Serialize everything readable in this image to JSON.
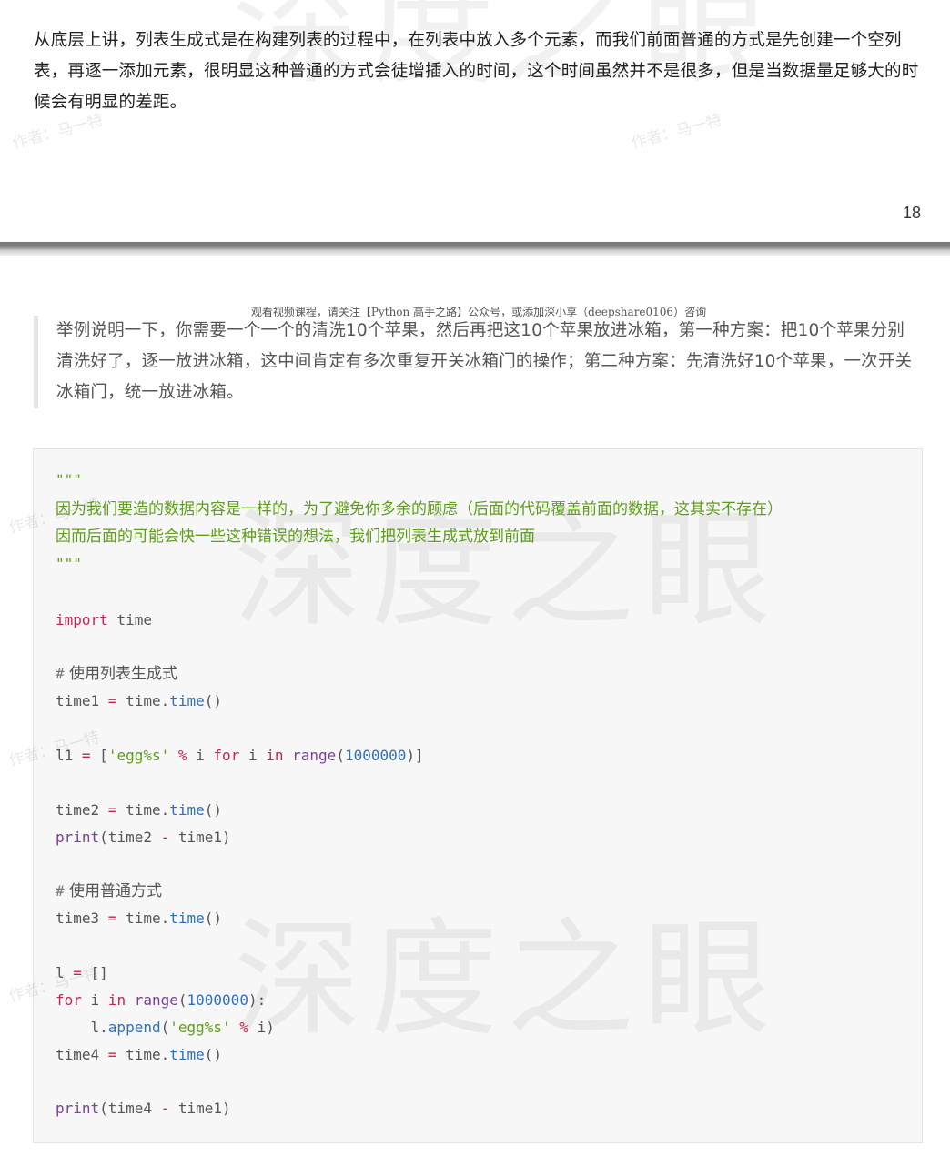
{
  "page_top": {
    "paragraph": "从底层上讲，列表生成式是在构建列表的过程中，在列表中放入多个元素，而我们前面普通的方式是先创建一个空列表，再逐一添加元素，很明显这种普通的方式会徒增插入的时间，这个时间虽然并不是很多，但是当数据量足够大的时候会有明显的差距。",
    "page_number": "18"
  },
  "page_bottom": {
    "header_note": "观看视频课程，请关注【Python 高手之路】公众号，或添加深小享（deepshare0106）咨询",
    "quote": "举例说明一下，你需要一个一个的清洗10个苹果，然后再把这10个苹果放进冰箱，第一种方案：把10个苹果分别清洗好了，逐一放进冰箱，这中间肯定有多次重复开关冰箱门的操作；第二种方案：先清洗好10个苹果，一次开关冰箱门，统一放进冰箱。"
  },
  "watermarks": {
    "big": "深度之眼",
    "small": "作者：马一特"
  },
  "code": {
    "doc_open": "\"\"\"",
    "doc_line1": "因为我们要造的数据内容是一样的，为了避免你多余的顾虑（后面的代码覆盖前面的数据，这其实不存在）",
    "doc_line2": "因而后面的可能会快一些这种错误的想法，我们把列表生成式放到前面",
    "doc_close": "\"\"\"",
    "import_kw": "import",
    "import_mod": " time",
    "comment_hash": "#",
    "comment1": " 使用列表生成式",
    "t1_var": "time1 ",
    "t1_eq": "=",
    "t1_mod": " time.",
    "t1_fn": "time",
    "t1_paren": "()",
    "l1_var": "l1 ",
    "l1_eq": "=",
    "l1_open": " [",
    "l1_str": "'egg%s'",
    "l1_mod": " %",
    "l1_i": " i ",
    "l1_for": "for",
    "l1_i2": " i ",
    "l1_in": "in",
    "l1_range": " range",
    "l1_p1": "(",
    "l1_num": "1000000",
    "l1_close": ")]",
    "t2_var": "time2 ",
    "t2_eq": "=",
    "t2_mod": " time.",
    "t2_fn": "time",
    "t2_paren": "()",
    "p1_fn": "print",
    "p1_open": "(time2 ",
    "p1_minus": "-",
    "p1_rest": " time1)",
    "comment2": " 使用普通方式",
    "t3_var": "time3 ",
    "t3_eq": "=",
    "t3_mod": " time.",
    "t3_fn": "time",
    "t3_paren": "()",
    "l_var": "l ",
    "l_eq": "=",
    "l_val": " []",
    "for_kw": "for",
    "for_i": " i ",
    "for_in": "in",
    "for_range": " range",
    "for_p1": "(",
    "for_num": "1000000",
    "for_p2": "):",
    "app_indent": "    l.",
    "app_fn": "append",
    "app_p1": "(",
    "app_str": "'egg%s'",
    "app_mod": " %",
    "app_rest": " i)",
    "t4_var": "time4 ",
    "t4_eq": "=",
    "t4_mod": " time.",
    "t4_fn": "time",
    "t4_paren": "()",
    "p2_fn": "print",
    "p2_open": "(time4 ",
    "p2_minus": "-",
    "p2_rest": " time1)"
  }
}
